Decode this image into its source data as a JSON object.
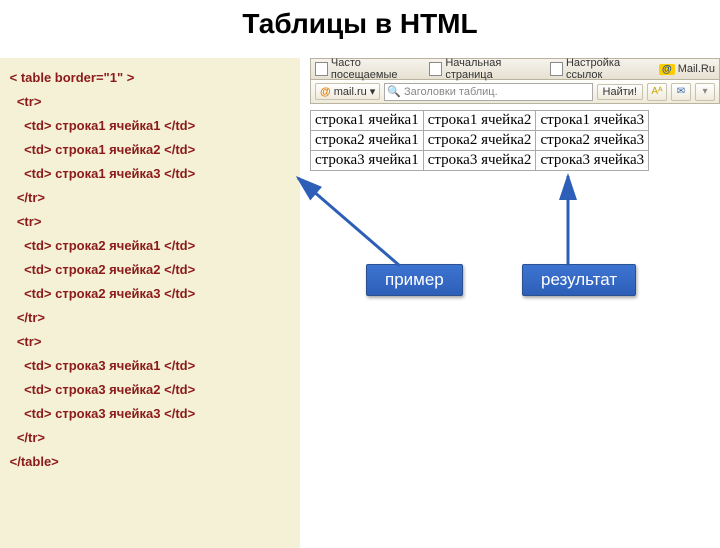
{
  "title": "Таблицы в HTML",
  "code": {
    "table_open": "< table border=\"1\" >",
    "tr_open": "<tr>",
    "tr_close": "</tr>",
    "table_close": "</table>",
    "rows": [
      [
        "<td> строка1 ячейка1 </td>",
        "<td> строка1 ячейка2 </td>",
        "<td> строка1 ячейка3 </td>"
      ],
      [
        "<td> строка2 ячейка1 </td>",
        "<td> строка2 ячейка2 </td>",
        "<td> строка2 ячейка3 </td>"
      ],
      [
        "<td> строка3 ячейка1 </td>",
        "<td> строка3 ячейка2 </td>",
        "<td> строка3 ячейка3 </td>"
      ]
    ]
  },
  "toolbar1": {
    "freq": "Часто посещаемые",
    "home": "Начальная страница",
    "links": "Настройка ссылок",
    "mailru": "Mail.Ru"
  },
  "toolbar2": {
    "mail": "mail.ru",
    "search_placeholder": "Заголовки таблиц.",
    "find": "Найти!"
  },
  "result_table": [
    [
      "строка1 ячейка1",
      "строка1 ячейка2",
      "строка1 ячейка3"
    ],
    [
      "строка2 ячейка1",
      "строка2 ячейка2",
      "строка2 ячейка3"
    ],
    [
      "строка3 ячейка1",
      "строка3 ячейка2",
      "строка3 ячейка3"
    ]
  ],
  "callouts": {
    "example": "пример",
    "result": "результат"
  }
}
